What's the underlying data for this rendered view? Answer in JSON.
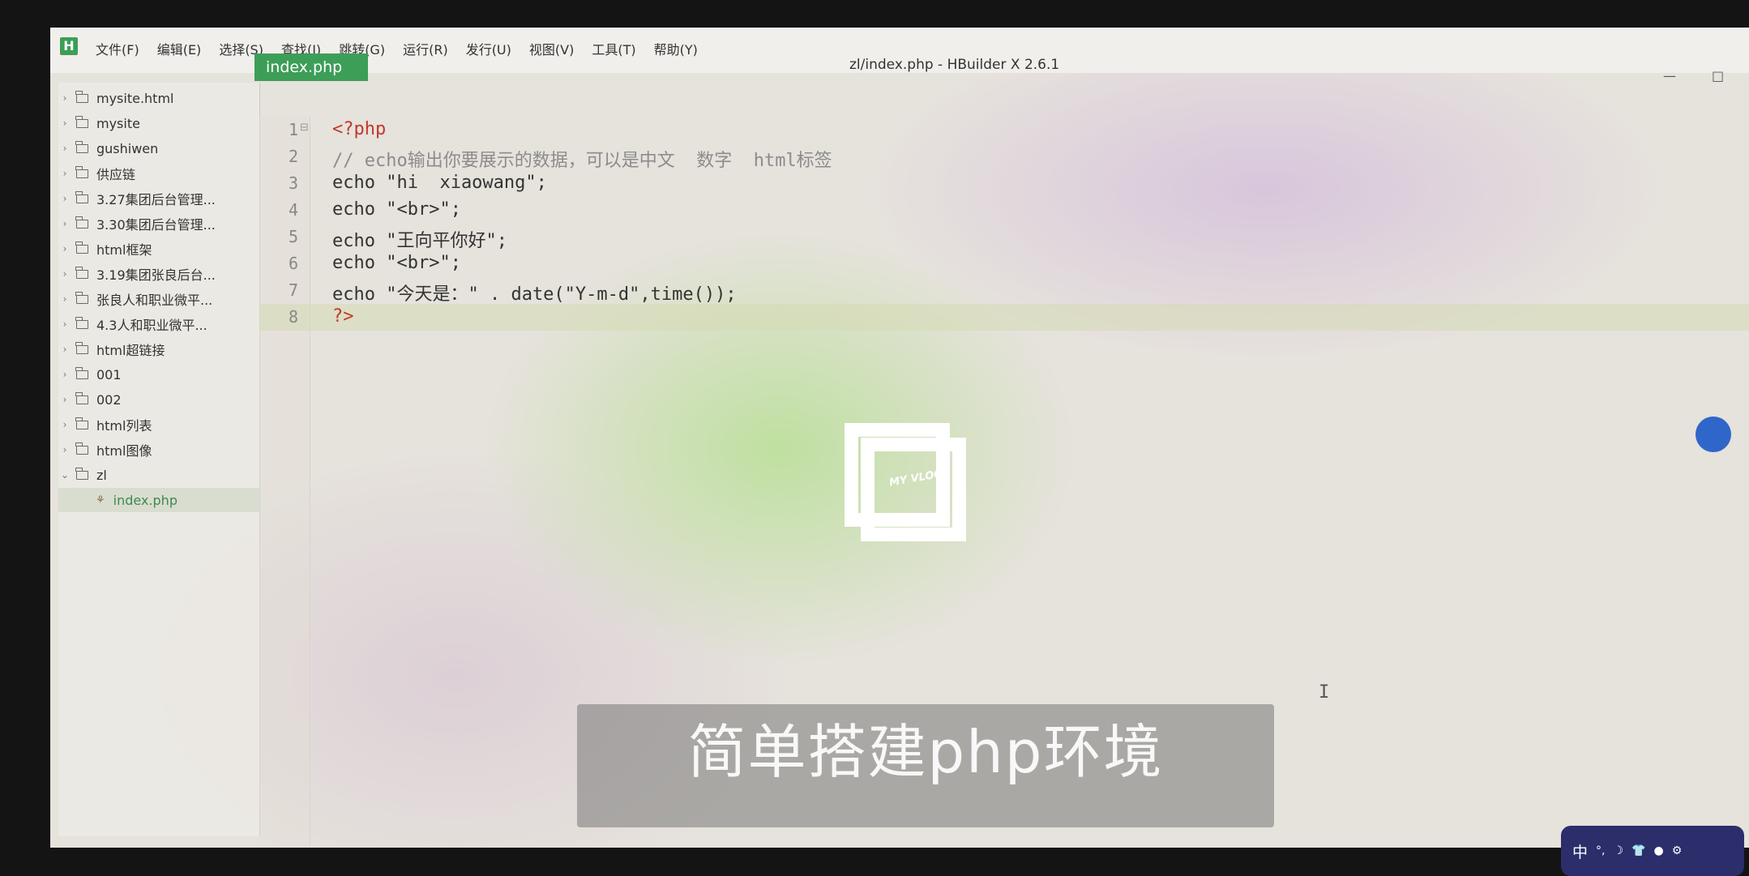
{
  "window": {
    "title": "zl/index.php - HBuilder X 2.6.1",
    "logo": "H",
    "minimize": "—",
    "maximize": "□"
  },
  "menu": [
    "文件(F)",
    "编辑(E)",
    "选择(S)",
    "查找(I)",
    "跳转(G)",
    "运行(R)",
    "发行(U)",
    "视图(V)",
    "工具(T)",
    "帮助(Y)"
  ],
  "sidebar": {
    "items": [
      {
        "label": "mysite.html",
        "expanded": false
      },
      {
        "label": "mysite",
        "expanded": false
      },
      {
        "label": "gushiwen",
        "expanded": false
      },
      {
        "label": "供应链",
        "expanded": false
      },
      {
        "label": "3.27集团后台管理...",
        "expanded": false
      },
      {
        "label": "3.30集团后台管理...",
        "expanded": false
      },
      {
        "label": "html框架",
        "expanded": false
      },
      {
        "label": "3.19集团张良后台...",
        "expanded": false
      },
      {
        "label": "张良人和职业微平...",
        "expanded": false
      },
      {
        "label": "4.3人和职业微平...",
        "expanded": false
      },
      {
        "label": "html超链接",
        "expanded": false
      },
      {
        "label": "001",
        "expanded": false
      },
      {
        "label": "002",
        "expanded": false
      },
      {
        "label": "html列表",
        "expanded": false
      },
      {
        "label": "html图像",
        "expanded": false
      },
      {
        "label": "zl",
        "expanded": true
      }
    ],
    "file": {
      "label": "index.php",
      "icon": "php-file-icon",
      "selected": true
    }
  },
  "tabs": [
    {
      "label": "index.php",
      "active": true
    }
  ],
  "editor": {
    "lines": [
      {
        "no": "1",
        "fold": "⊟",
        "parts": [
          {
            "t": "<?php",
            "c": "c-tag"
          }
        ]
      },
      {
        "no": "2",
        "fold": "",
        "parts": [
          {
            "t": "// echo输出你要展示的数据，可以是中文  数字  html标签",
            "c": "c-comment"
          }
        ]
      },
      {
        "no": "3",
        "fold": "",
        "parts": [
          {
            "t": "echo \"hi  xiaowang\";",
            "c": "c-kw"
          }
        ]
      },
      {
        "no": "4",
        "fold": "",
        "parts": [
          {
            "t": "echo \"<br>\";",
            "c": "c-kw"
          }
        ]
      },
      {
        "no": "5",
        "fold": "",
        "parts": [
          {
            "t": "echo \"王向平你好\";",
            "c": "c-kw"
          }
        ]
      },
      {
        "no": "6",
        "fold": "",
        "parts": [
          {
            "t": "echo \"<br>\";",
            "c": "c-kw"
          }
        ]
      },
      {
        "no": "7",
        "fold": "",
        "parts": [
          {
            "t": "echo \"今天是：\" . date(\"Y-m-d\",time());",
            "c": "c-kw"
          }
        ]
      },
      {
        "no": "8",
        "fold": "",
        "parts": [
          {
            "t": "?>",
            "c": "c-tag"
          }
        ],
        "current": true
      }
    ]
  },
  "overlay": {
    "vlog_logo_text": "MY VLOG",
    "subtitle": "简单搭建php环境"
  },
  "ime": {
    "mode": "中",
    "icons": [
      "°,",
      "☽",
      "👕",
      "●",
      "⚙"
    ]
  }
}
